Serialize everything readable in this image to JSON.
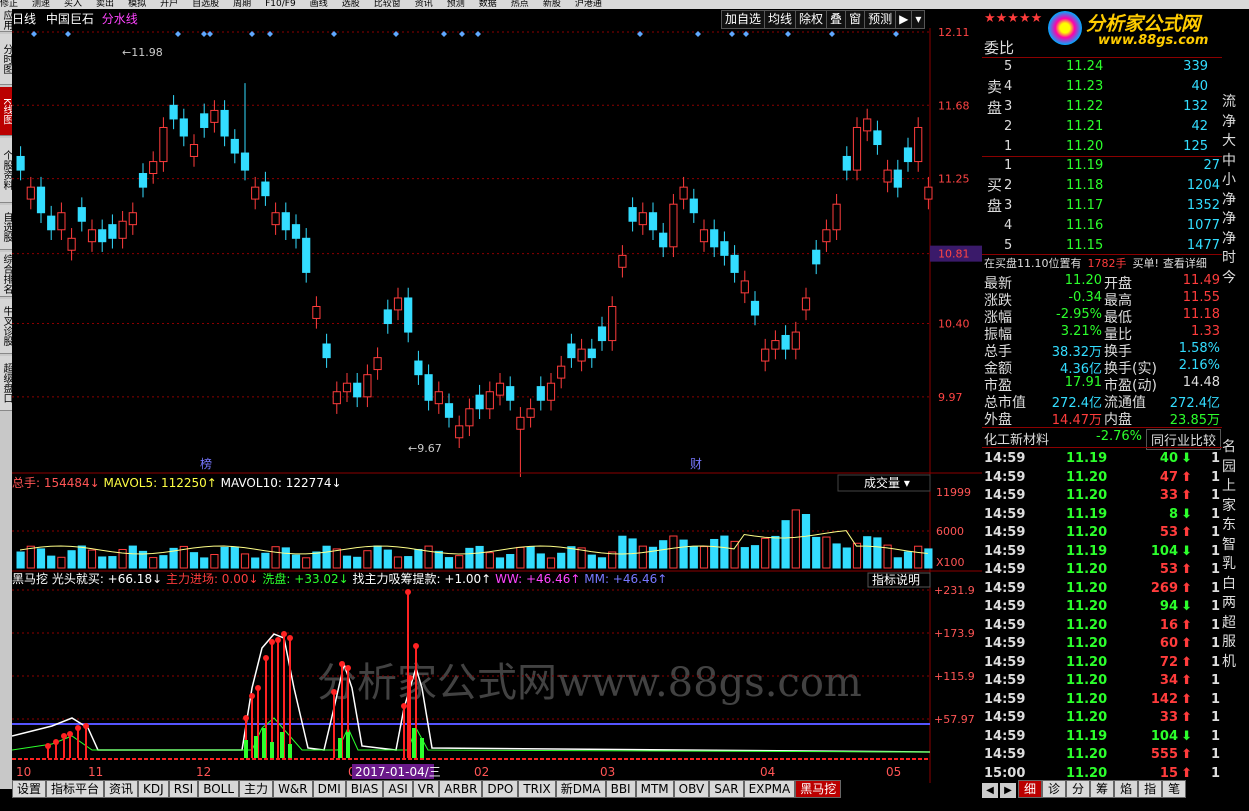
{
  "topbar": [
    "修正",
    "测速",
    "买入",
    "卖出",
    "模拟",
    "开户",
    "自选股",
    "周期",
    "F10/F9",
    "画线",
    "选股",
    "比较窗",
    "资讯",
    "预测",
    "数据",
    "热点",
    "新股",
    "沪港通"
  ],
  "left_tabs": [
    {
      "label": "应用",
      "active": false
    },
    {
      "label": "分时图",
      "active": false
    },
    {
      "label": "K线图",
      "active": true
    },
    {
      "label": "个股资料",
      "active": false
    },
    {
      "label": "自选股",
      "active": false
    },
    {
      "label": "综合排名",
      "active": false
    },
    {
      "label": "牛叉诊股",
      "active": false
    },
    {
      "label": "超级盘口",
      "active": false
    }
  ],
  "chart_header": {
    "period": "日线",
    "stock": "中国巨石",
    "formula": "分水线"
  },
  "toolbar": [
    "加自选",
    "均线",
    "除权",
    "叠",
    "窗",
    "预测"
  ],
  "price_axis": [
    "12.11",
    "11.68",
    "11.25",
    "10.81",
    "10.40",
    "9.97"
  ],
  "current_price_label": "10.81",
  "hi_annot": "11.98",
  "lo_annot": "9.67",
  "markers": [
    "榜",
    "财"
  ],
  "volume_header": {
    "name": "总手",
    "value": "154484",
    "ma5_label": "MAVOL5:",
    "ma5": "112250",
    "ma10_label": "MAVOL10:",
    "ma10": "122774",
    "selector": "成交量"
  },
  "volume_axis": [
    "11999",
    "6000",
    "X100"
  ],
  "indicator_header": {
    "name": "黑马挖",
    "f1": "光头就买: +66.18",
    "f2": "主力进场: 0.00",
    "f3": "洗盘: +33.02",
    "f4": "找主力吸筹提款: +1.00",
    "f5": "WW: +46.46",
    "f6": "MM: +46.46",
    "button": "指标说明"
  },
  "indicator_axis": [
    "+231.9",
    "+173.9",
    "+115.9",
    "+57.97"
  ],
  "x_axis": [
    "10",
    "11",
    "12",
    "01",
    "02",
    "03",
    "04",
    "05"
  ],
  "date_tag": "2017-01-04/三",
  "watermark": "分析家公式网www.88gs.com",
  "logo": {
    "title": "分析家公式网",
    "url": "www.88gs.com",
    "stars": "★★★★★"
  },
  "order_book_title": "委比",
  "sell_label": "卖盘",
  "buy_label": "买盘",
  "asks": [
    {
      "lvl": "5",
      "price": "11.24",
      "vol": "339"
    },
    {
      "lvl": "4",
      "price": "11.23",
      "vol": "40"
    },
    {
      "lvl": "3",
      "price": "11.22",
      "vol": "132"
    },
    {
      "lvl": "2",
      "price": "11.21",
      "vol": "42"
    },
    {
      "lvl": "1",
      "price": "11.20",
      "vol": "125"
    }
  ],
  "bids": [
    {
      "lvl": "1",
      "price": "11.19",
      "vol": "27"
    },
    {
      "lvl": "2",
      "price": "11.18",
      "vol": "1204"
    },
    {
      "lvl": "3",
      "price": "11.17",
      "vol": "1352"
    },
    {
      "lvl": "4",
      "price": "11.16",
      "vol": "1077"
    },
    {
      "lvl": "5",
      "price": "11.15",
      "vol": "1477"
    }
  ],
  "bid_note": {
    "text": "在买盘11.10位置有",
    "qty": "1782手",
    "tail": "买单!",
    "link": "查看详细"
  },
  "quote": [
    {
      "k1": "最新",
      "v1": "11.20",
      "k2": "开盘",
      "v2": "11.49"
    },
    {
      "k1": "涨跌",
      "v1": "-0.34",
      "k2": "最高",
      "v2": "11.55"
    },
    {
      "k1": "涨幅",
      "v1": "-2.95%",
      "k2": "最低",
      "v2": "11.18"
    },
    {
      "k1": "振幅",
      "v1": "3.21%",
      "k2": "量比",
      "v2": "1.33"
    },
    {
      "k1": "总手",
      "v1": "38.32万",
      "k2": "换手",
      "v2": "1.58%"
    },
    {
      "k1": "金额",
      "v1": "4.36亿",
      "k2": "换手(实)",
      "v2": "2.16%"
    },
    {
      "k1": "市盈",
      "v1": "17.91",
      "k2": "市盈(动)",
      "v2": "14.48"
    },
    {
      "k1": "总市值",
      "v1": "272.4亿",
      "k2": "流通值",
      "v2": "272.4亿"
    },
    {
      "k1": "外盘",
      "v1": "14.47万",
      "k2": "内盘",
      "v2": "23.85万"
    }
  ],
  "sector": {
    "name": "化工新材料",
    "change": "-2.76%",
    "button": "同行业比较"
  },
  "ticks": [
    {
      "t": "14:59",
      "p": "11.19",
      "v": "40",
      "d": "down"
    },
    {
      "t": "14:59",
      "p": "11.20",
      "v": "47",
      "d": "up"
    },
    {
      "t": "14:59",
      "p": "11.20",
      "v": "33",
      "d": "up"
    },
    {
      "t": "14:59",
      "p": "11.19",
      "v": "8",
      "d": "down"
    },
    {
      "t": "14:59",
      "p": "11.20",
      "v": "53",
      "d": "up"
    },
    {
      "t": "14:59",
      "p": "11.19",
      "v": "104",
      "d": "down"
    },
    {
      "t": "14:59",
      "p": "11.20",
      "v": "53",
      "d": "up"
    },
    {
      "t": "14:59",
      "p": "11.20",
      "v": "269",
      "d": "up"
    },
    {
      "t": "14:59",
      "p": "11.20",
      "v": "94",
      "d": "down"
    },
    {
      "t": "14:59",
      "p": "11.20",
      "v": "16",
      "d": "up"
    },
    {
      "t": "14:59",
      "p": "11.20",
      "v": "60",
      "d": "up"
    },
    {
      "t": "14:59",
      "p": "11.20",
      "v": "72",
      "d": "up"
    },
    {
      "t": "14:59",
      "p": "11.20",
      "v": "34",
      "d": "up"
    },
    {
      "t": "14:59",
      "p": "11.20",
      "v": "142",
      "d": "up"
    },
    {
      "t": "14:59",
      "p": "11.20",
      "v": "33",
      "d": "up"
    },
    {
      "t": "14:59",
      "p": "11.19",
      "v": "104",
      "d": "down"
    },
    {
      "t": "14:59",
      "p": "11.20",
      "v": "555",
      "d": "up"
    },
    {
      "t": "15:00",
      "p": "11.20",
      "v": "15",
      "d": "up"
    }
  ],
  "right_edge": [
    "流",
    "净",
    "大",
    "中",
    "小",
    "净",
    "净",
    "净",
    "时",
    "今",
    "名",
    "园",
    "上",
    "家",
    "东",
    "智",
    "乳",
    "白",
    "两",
    "超",
    "服",
    "机"
  ],
  "right_tabs": [
    "细",
    "诊",
    "分",
    "筹",
    "焰",
    "指",
    "笔"
  ],
  "bottom_tabs": [
    {
      "label": "设置",
      "active": false
    },
    {
      "label": "指标平台",
      "active": false
    },
    {
      "label": "资讯",
      "active": false
    },
    {
      "label": "KDJ",
      "active": false
    },
    {
      "label": "RSI",
      "active": false
    },
    {
      "label": "BOLL",
      "active": false
    },
    {
      "label": "主力",
      "active": false
    },
    {
      "label": "W&R",
      "active": false
    },
    {
      "label": "DMI",
      "active": false
    },
    {
      "label": "BIAS",
      "active": false
    },
    {
      "label": "ASI",
      "active": false
    },
    {
      "label": "VR",
      "active": false
    },
    {
      "label": "ARBR",
      "active": false
    },
    {
      "label": "DPO",
      "active": false
    },
    {
      "label": "TRIX",
      "active": false
    },
    {
      "label": "新DMA",
      "active": false
    },
    {
      "label": "BBI",
      "active": false
    },
    {
      "label": "MTM",
      "active": false
    },
    {
      "label": "OBV",
      "active": false
    },
    {
      "label": "SAR",
      "active": false
    },
    {
      "label": "EXPMA",
      "active": false
    },
    {
      "label": "黑马挖",
      "active": true
    }
  ],
  "colors": {
    "up": "#ff3c3c",
    "down": "#33ddff",
    "grid": "#8b0000",
    "accent": "#ff44ff"
  }
}
